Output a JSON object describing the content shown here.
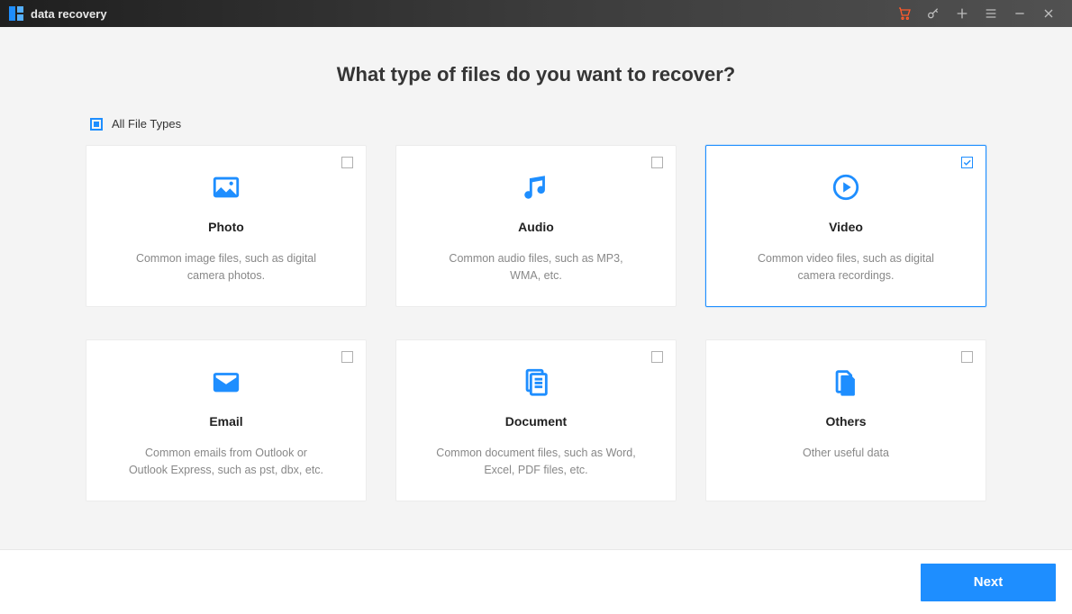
{
  "app": {
    "title": "data recovery"
  },
  "heading": "What type of files do you want to recover?",
  "select_all": {
    "label": "All File Types",
    "state": "indeterminate"
  },
  "cards": [
    {
      "id": "photo",
      "title": "Photo",
      "desc": "Common image files, such as digital camera photos.",
      "selected": false,
      "icon": "photo-icon"
    },
    {
      "id": "audio",
      "title": "Audio",
      "desc": "Common audio files, such as MP3, WMA, etc.",
      "selected": false,
      "icon": "audio-icon"
    },
    {
      "id": "video",
      "title": "Video",
      "desc": "Common video files, such as digital camera recordings.",
      "selected": true,
      "icon": "video-icon"
    },
    {
      "id": "email",
      "title": "Email",
      "desc": "Common emails from Outlook or Outlook Express, such as pst, dbx, etc.",
      "selected": false,
      "icon": "email-icon"
    },
    {
      "id": "document",
      "title": "Document",
      "desc": "Common document files, such as Word, Excel, PDF files, etc.",
      "selected": false,
      "icon": "document-icon"
    },
    {
      "id": "others",
      "title": "Others",
      "desc": "Other useful data",
      "selected": false,
      "icon": "others-icon"
    }
  ],
  "footer": {
    "next_label": "Next"
  },
  "colors": {
    "accent": "#1e8eff",
    "brand_orange": "#ff5a2b"
  }
}
